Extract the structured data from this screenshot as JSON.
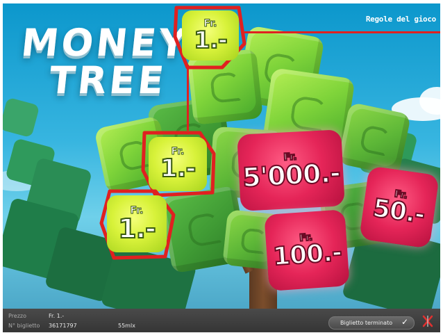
{
  "game": {
    "logo_line1": "MONEY",
    "logo_line2": "TREE",
    "rules_link": "Regole del gioco",
    "currency": "Fr.",
    "prizes": [
      {
        "amount": "1.-",
        "type": "winning",
        "color": "#d8f23a"
      },
      {
        "amount": "1.-",
        "type": "winning",
        "color": "#d8f23a"
      },
      {
        "amount": "1.-",
        "type": "winning",
        "color": "#d8f23a"
      },
      {
        "amount": "5'000.-",
        "type": "prize",
        "color": "#e52558"
      },
      {
        "amount": "50.-",
        "type": "prize",
        "color": "#e52558"
      },
      {
        "amount": "100.-",
        "type": "prize",
        "color": "#e52558"
      }
    ],
    "highlight_color": "#e02020"
  },
  "footer": {
    "price_label": "Prezzo",
    "price_value": "Fr. 1.-",
    "ticket_label": "N° biglietto",
    "ticket_value": "36171797",
    "extra_value": "55mlx",
    "status_button": "Biglietto terminato",
    "check_icon": "check-icon",
    "close_icon": "close-icon"
  }
}
